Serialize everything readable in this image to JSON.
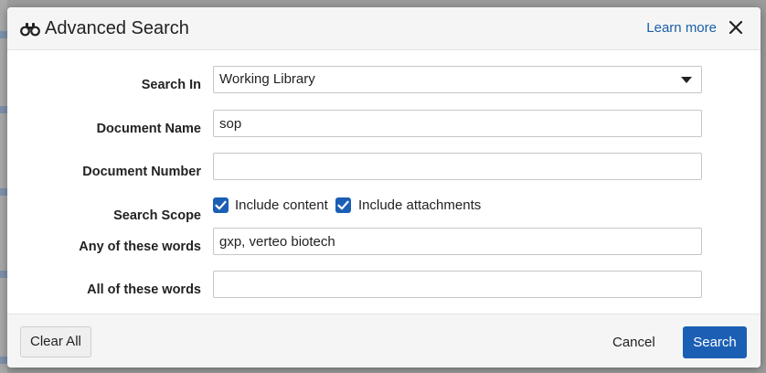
{
  "dialog": {
    "title": "Advanced Search",
    "learn_more": "Learn more",
    "icons": {
      "title": "binoculars-icon",
      "close": "close-icon",
      "dropdown": "chevron-down-icon",
      "checkbox": "checkmark-icon"
    }
  },
  "form": {
    "search_in": {
      "label": "Search In",
      "value": "Working Library"
    },
    "document_name": {
      "label": "Document Name",
      "value": "sop"
    },
    "document_number": {
      "label": "Document Number",
      "value": ""
    },
    "search_scope": {
      "label": "Search Scope",
      "include_content": {
        "label": "Include content",
        "checked": true
      },
      "include_attachments": {
        "label": "Include attachments",
        "checked": true
      }
    },
    "any_words": {
      "label": "Any of these words",
      "value": "gxp, verteo biotech"
    },
    "all_words": {
      "label": "All of these words",
      "value": ""
    }
  },
  "footer": {
    "clear_label": "Clear All",
    "cancel_label": "Cancel",
    "search_label": "Search"
  },
  "colors": {
    "accent": "#1a5fb4",
    "link": "#1a5fa8",
    "header_bg": "#f5f5f5",
    "overlay": "#8a8a8a"
  }
}
